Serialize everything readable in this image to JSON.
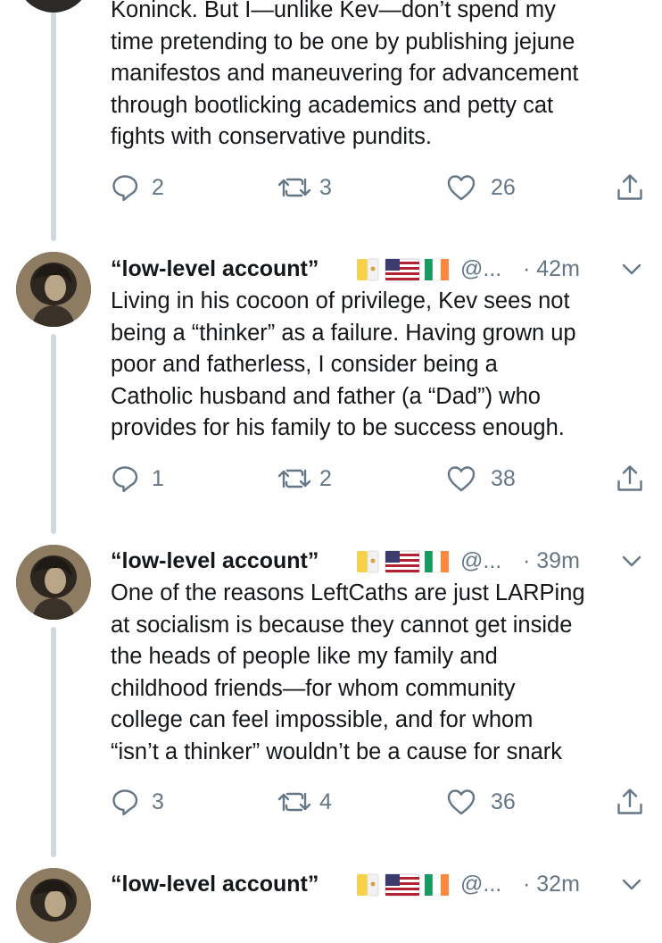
{
  "tweets": [
    {
      "lines": [
        "Koninck. But I—unlike Kev—don’t spend my",
        "time pretending to be one by publishing jejune",
        "manifestos and maneuvering for advancement",
        "through bootlicking academics and petty cat",
        "fights with conservative pundits."
      ],
      "replies": "2",
      "retweets": "3",
      "likes": "26"
    },
    {
      "name": "“low-level account”",
      "handle": "@...",
      "time": "· 42m",
      "lines": [
        "Living in his cocoon of privilege, Kev sees not",
        "being a “thinker” as a failure. Having grown up",
        "poor and fatherless, I consider being a",
        "Catholic husband and father (a “Dad”) who",
        "provides for his family to be success enough."
      ],
      "replies": "1",
      "retweets": "2",
      "likes": "38"
    },
    {
      "name": "“low-level account”",
      "handle": "@...",
      "time": "· 39m",
      "lines": [
        "One of the reasons LeftCaths are just LARPing",
        "at socialism is because they cannot get inside",
        "the heads of people like my family and",
        "childhood friends—for whom community",
        "college can feel impossible, and for whom",
        "“isn’t a thinker” wouldn’t be a cause for snark"
      ],
      "replies": "3",
      "retweets": "4",
      "likes": "36"
    },
    {
      "name": "“low-level account”",
      "handle": "@...",
      "time": "· 32m"
    }
  ],
  "icons": {
    "reply": "speech-bubble-icon",
    "retweet": "retweet-arrows-icon",
    "like": "heart-icon",
    "share": "share-upload-icon",
    "caret": "chevron-down-icon"
  },
  "colors": {
    "text": "#14171a",
    "secondary": "#657786",
    "thread_line": "#cfd9de"
  }
}
